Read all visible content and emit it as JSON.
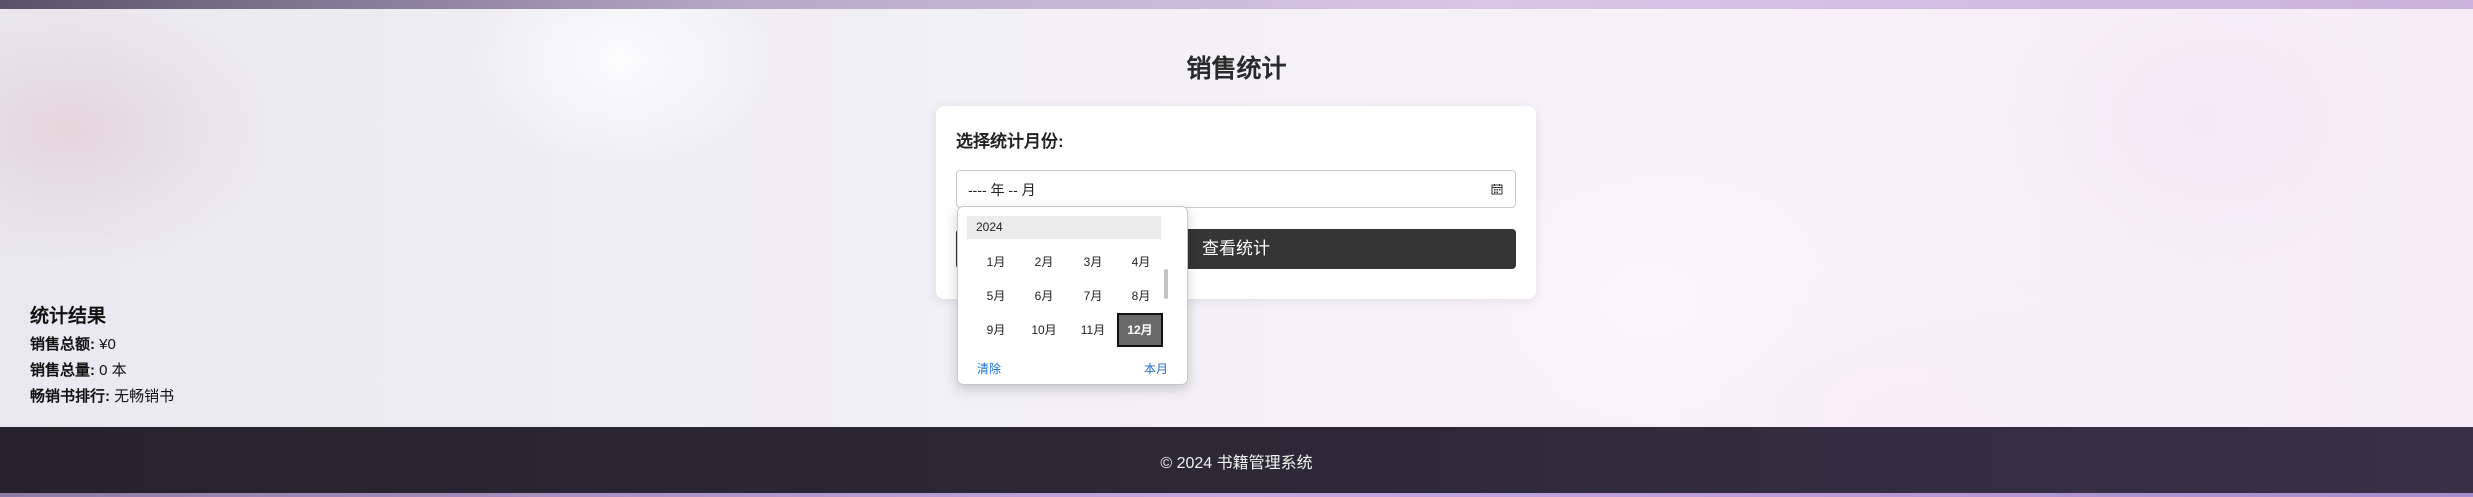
{
  "page": {
    "title": "销售统计"
  },
  "form": {
    "label": "选择统计月份:",
    "month_input_value": "---- 年 -- 月",
    "submit_label": "查看统计"
  },
  "picker": {
    "year": "2024",
    "months": [
      "1月",
      "2月",
      "3月",
      "4月",
      "5月",
      "6月",
      "7月",
      "8月",
      "9月",
      "10月",
      "11月",
      "12月"
    ],
    "selected_month": "12月",
    "clear_label": "清除",
    "this_month_label": "本月"
  },
  "results": {
    "title": "统计结果",
    "total_amount_label": "销售总额:",
    "total_amount_value": "¥0",
    "total_qty_label": "销售总量:",
    "total_qty_value": "0 本",
    "bestseller_label": "畅销书排行:",
    "bestseller_value": "无畅销书"
  },
  "footer": {
    "text": "© 2024 书籍管理系统"
  },
  "icons": {
    "month_input_icon": "calendar-icon"
  },
  "colors": {
    "button_bg": "#353535",
    "footer_bg": "#2c2836",
    "link": "#1a6fd0",
    "selected_month_bg": "#6a6a6a"
  }
}
